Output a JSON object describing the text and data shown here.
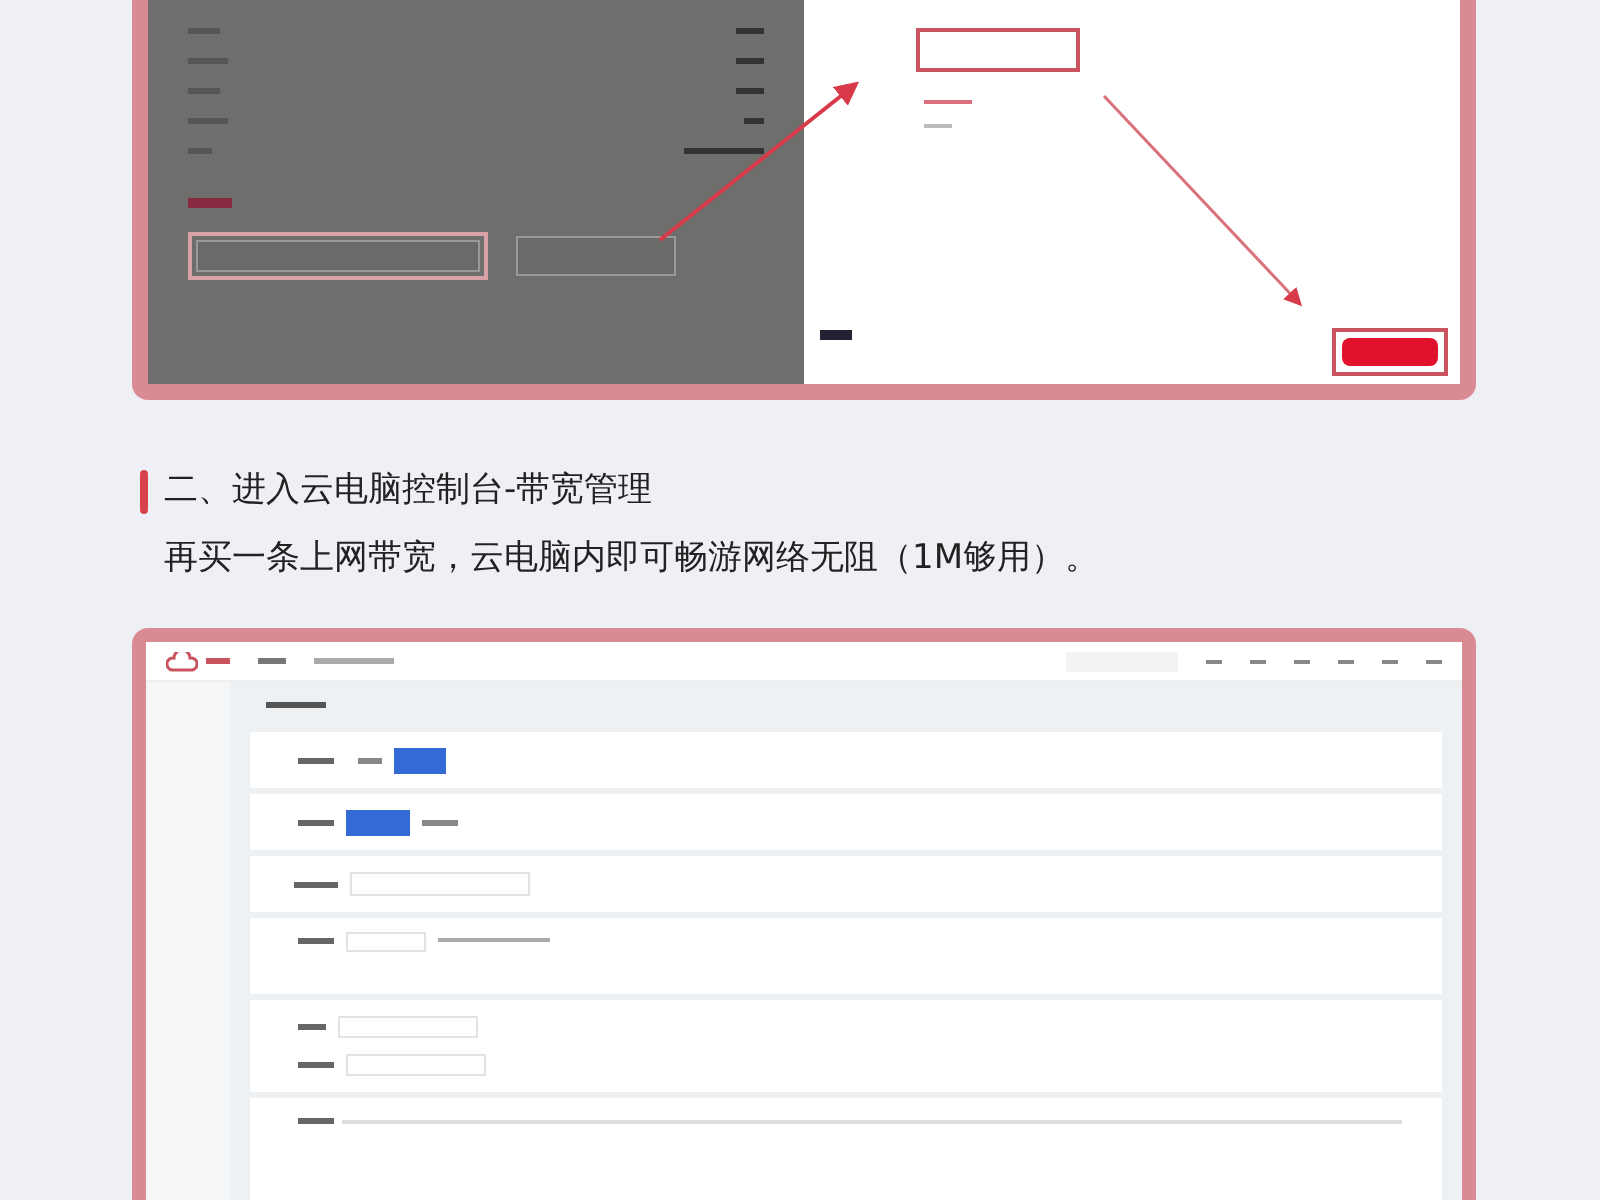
{
  "section": {
    "title": "二、进入云电脑控制台-带宽管理",
    "description": "再买一条上网带宽，云电脑内即可畅游网络无阻（1M够用）。"
  }
}
